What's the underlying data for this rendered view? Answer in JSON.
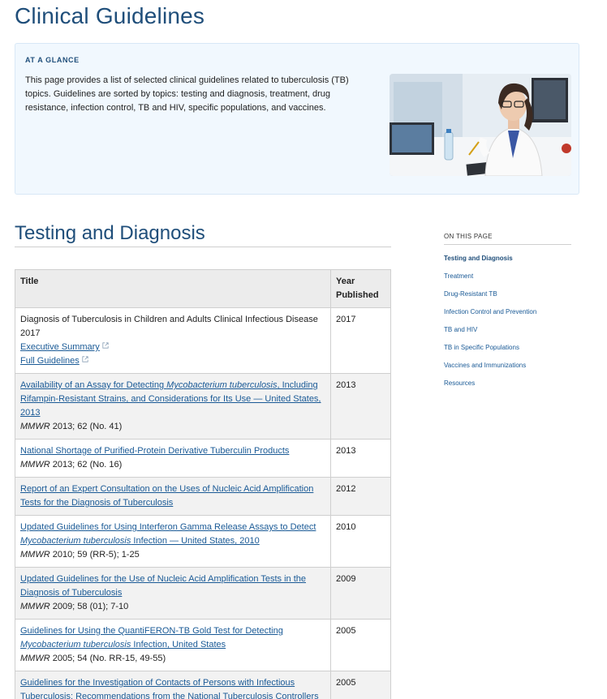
{
  "page": {
    "title": "Clinical Guidelines"
  },
  "glance": {
    "heading": "AT A GLANCE",
    "text": "This page provides a list of selected clinical guidelines related to tuberculosis (TB) topics. Guidelines are sorted by topics: testing and diagnosis, treatment, drug resistance, infection control, TB and HIV, specific populations, and vaccines."
  },
  "section": {
    "title": "Testing and Diagnosis"
  },
  "table": {
    "headers": {
      "title": "Title",
      "year": "Year Published"
    },
    "rows": [
      {
        "plain": "Diagnosis of Tuberculosis in Children and Adults Clinical Infectious Disease 2017",
        "links": [
          "Executive Summary",
          "Full Guidelines"
        ],
        "year": "2017"
      },
      {
        "link_pre": "Availability of an Assay for Detecting ",
        "link_em": "Mycobacterium tuberculosis",
        "link_post": ", Including Rifampin-Resistant Strains, and Considerations for Its Use — United States, 2013",
        "cite_em": "MMWR",
        "cite": " 2013; 62 (No. 41)",
        "year": "2013"
      },
      {
        "link_pre": "National Shortage of Purified-Protein Derivative Tuberculin Products",
        "cite_em": "MMWR",
        "cite": " 2013; 62 (No. 16)",
        "year": "2013"
      },
      {
        "link_pre": "Report of an Expert Consultation on the Uses of Nucleic Acid Amplification Tests for the Diagnosis of Tuberculosis",
        "year": "2012"
      },
      {
        "link_pre": "Updated Guidelines for Using Interferon Gamma Release Assays to Detect ",
        "link_em": "Mycobacterium tuberculosis",
        "link_post": " Infection — United States, 2010",
        "cite_em": "MMWR",
        "cite": " 2010; 59 (RR-5); 1-25",
        "year": "2010"
      },
      {
        "link_pre": "Updated Guidelines for the Use of Nucleic Acid Amplification Tests in the Diagnosis of Tuberculosis",
        "cite_em": "MMWR",
        "cite": " 2009; 58 (01); 7-10",
        "year": "2009"
      },
      {
        "link_pre": "Guidelines for Using the QuantiFERON-TB Gold Test for Detecting ",
        "link_em": "Mycobacterium tuberculosis",
        "link_post": " Infection, United States",
        "cite_em": "MMWR",
        "cite": " 2005; 54 (No. RR-15, 49-55)",
        "year": "2005"
      },
      {
        "link_pre": "Guidelines for the Investigation of Contacts of Persons with Infectious Tuberculosis: Recommendations from the National Tuberculosis Controllers Association and CDC",
        "year": "2005"
      }
    ]
  },
  "on_this_page": {
    "heading": "ON THIS PAGE",
    "items": [
      "Testing and Diagnosis",
      "Treatment",
      "Drug-Resistant TB",
      "Infection Control and Prevention",
      "TB and HIV",
      "TB in Specific Populations",
      "Vaccines and Immunizations",
      "Resources"
    ],
    "active": "Testing and Diagnosis"
  },
  "icons": {
    "external_link": "external-link-icon"
  },
  "colors": {
    "heading": "#1f4e7a",
    "link": "#1a5a96",
    "glance_bg": "#f1f8fe"
  }
}
